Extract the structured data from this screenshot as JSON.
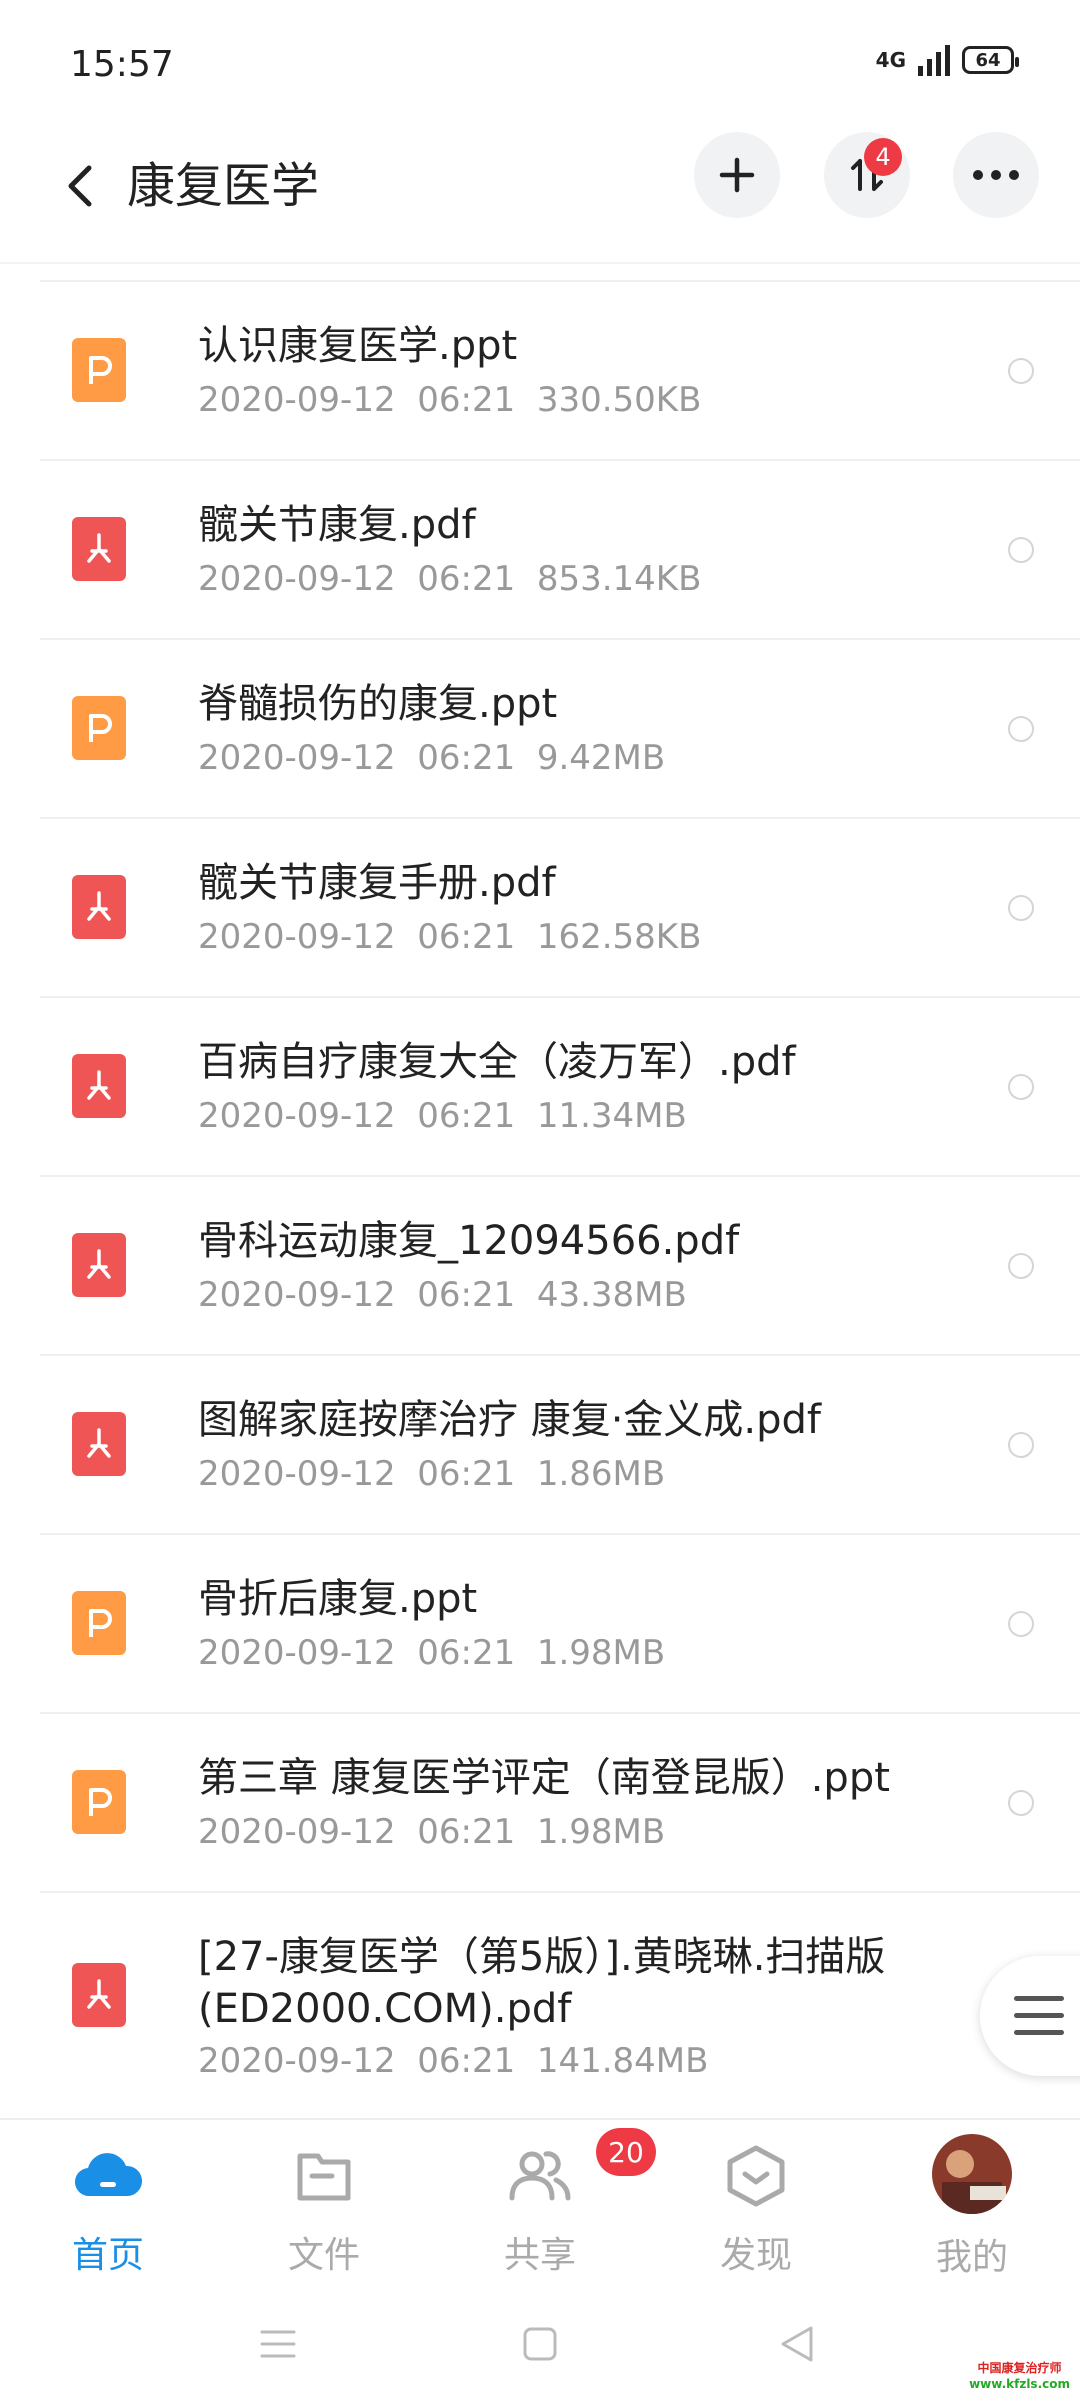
{
  "status_bar": {
    "time": "15:57",
    "network": "4G",
    "battery": "64"
  },
  "header": {
    "title": "康复医学",
    "transfer_badge": "4"
  },
  "files": [
    {
      "name": "认识康复医学.ppt",
      "date": "2020-09-12",
      "time": "06:21",
      "size": "330.50KB",
      "type": "ppt"
    },
    {
      "name": "髋关节康复.pdf",
      "date": "2020-09-12",
      "time": "06:21",
      "size": "853.14KB",
      "type": "pdf"
    },
    {
      "name": "脊髓损伤的康复.ppt",
      "date": "2020-09-12",
      "time": "06:21",
      "size": "9.42MB",
      "type": "ppt"
    },
    {
      "name": "髋关节康复手册.pdf",
      "date": "2020-09-12",
      "time": "06:21",
      "size": "162.58KB",
      "type": "pdf"
    },
    {
      "name": "百病自疗康复大全（凌万军）.pdf",
      "date": "2020-09-12",
      "time": "06:21",
      "size": "11.34MB",
      "type": "pdf"
    },
    {
      "name": "骨科运动康复_12094566.pdf",
      "date": "2020-09-12",
      "time": "06:21",
      "size": "43.38MB",
      "type": "pdf"
    },
    {
      "name": "图解家庭按摩治疗 康复·金义成.pdf",
      "date": "2020-09-12",
      "time": "06:21",
      "size": "1.86MB",
      "type": "pdf"
    },
    {
      "name": "骨折后康复.ppt",
      "date": "2020-09-12",
      "time": "06:21",
      "size": "1.98MB",
      "type": "ppt"
    },
    {
      "name": "第三章  康复医学评定（南登昆版）.ppt",
      "date": "2020-09-12",
      "time": "06:21",
      "size": "1.98MB",
      "type": "ppt"
    },
    {
      "name": "[27-康复医学（第5版）].黄晓琳.扫描版(ED2000.COM).pdf",
      "date": "2020-09-12",
      "time": "06:21",
      "size": "141.84MB",
      "type": "pdf"
    }
  ],
  "bottom_nav": {
    "items": [
      {
        "label": "首页",
        "icon": "cloud-icon",
        "active": true
      },
      {
        "label": "文件",
        "icon": "folder-icon"
      },
      {
        "label": "共享",
        "icon": "people-icon",
        "badge": "20"
      },
      {
        "label": "发现",
        "icon": "discover-icon"
      },
      {
        "label": "我的",
        "icon": "avatar"
      }
    ]
  },
  "watermark": {
    "line1": "中国康复治疗师",
    "line2": "www.kfzls.com"
  },
  "colors": {
    "accent": "#1a8fe6",
    "badge": "#ee3a44",
    "ppt": "#ff9a45",
    "pdf": "#f05555"
  }
}
